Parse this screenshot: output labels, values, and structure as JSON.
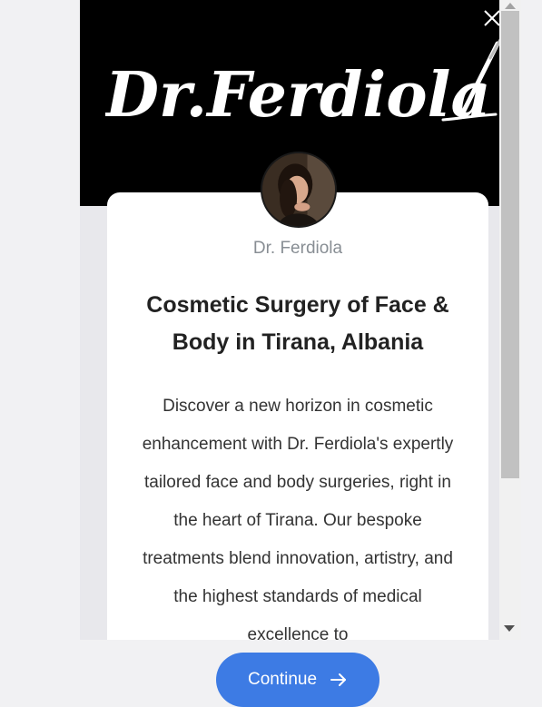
{
  "header": {
    "logo_text": "Dr.Ferdiola",
    "close_icon": "close-icon",
    "background_color": "#000000"
  },
  "card": {
    "avatar_icon": "avatar",
    "name": "Dr. Ferdiola",
    "title": "Cosmetic Surgery of Face & Body in Tirana, Albania",
    "description": "Discover a new horizon in cosmetic enhancement with Dr. Ferdiola's expertly tailored face and body surgeries, right in the heart of Tirana. Our bespoke treatments blend innovation, artistry, and the highest standards of medical excellence to"
  },
  "footer": {
    "continue_label": "Continue",
    "continue_icon": "arrow-right-icon",
    "accent_color": "#3d7be4"
  }
}
